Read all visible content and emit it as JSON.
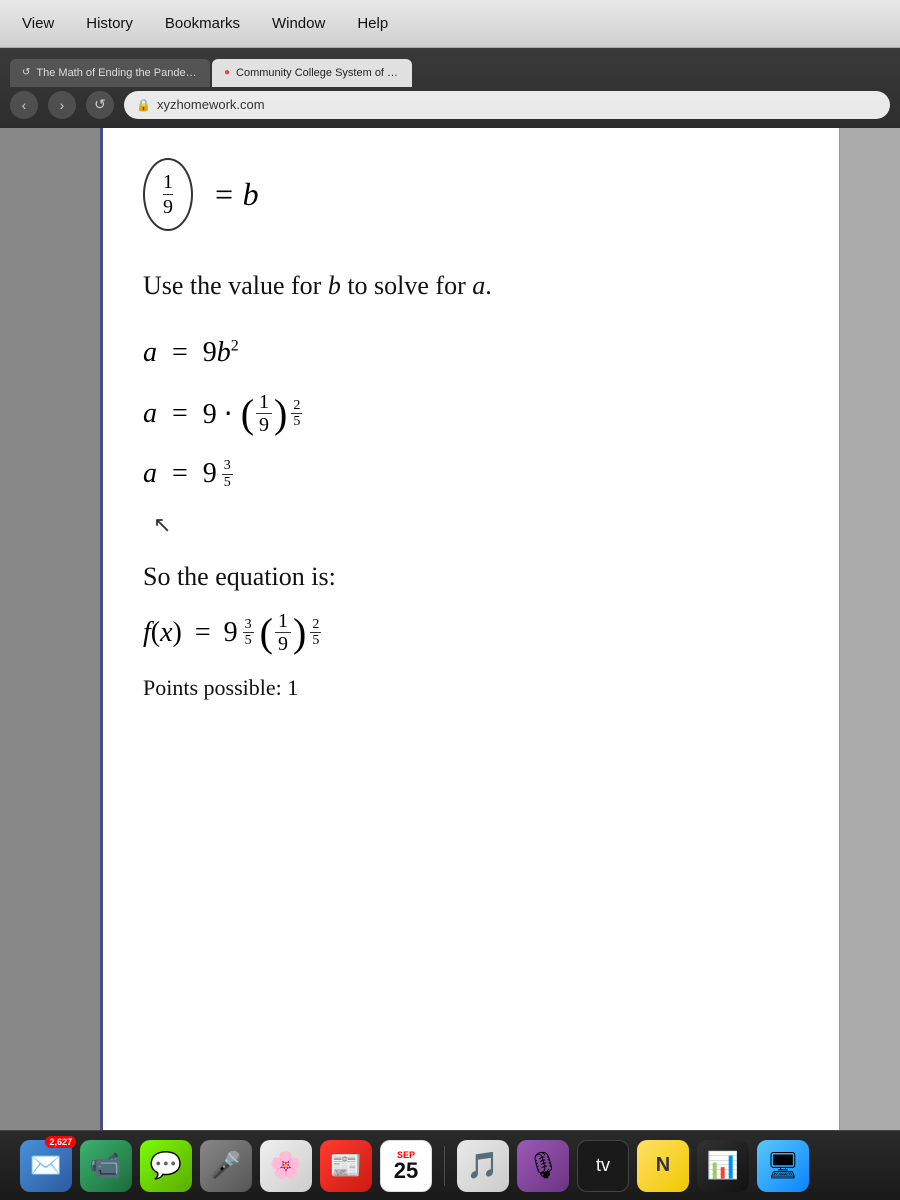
{
  "menubar": {
    "items": [
      "View",
      "History",
      "Bookmarks",
      "Window",
      "Help"
    ]
  },
  "browser": {
    "address": "xyzhomework.com",
    "lock_symbol": "🔒",
    "tabs": [
      {
        "title": "The Math of Ending the Pandemic: Expon...",
        "favicon": "↺",
        "active": false
      },
      {
        "title": "Community College System of New Ham...",
        "favicon": "○",
        "active": true
      }
    ]
  },
  "content": {
    "fraction_top": {
      "numerator": "1",
      "denominator": "9",
      "equals": "= b"
    },
    "use_value_text": "Use the value for b to solve for a.",
    "equations": [
      {
        "left": "a",
        "op": "=",
        "right": "9b²"
      },
      {
        "left": "a",
        "op": "=",
        "right": "9 · (1/9)^(2/5)"
      },
      {
        "left": "a",
        "op": "=",
        "right": "9^(3/5)"
      }
    ],
    "so_equation_text": "So the equation is:",
    "final_equation": "f(x) = 9^(3/5) · (1/9)^(2/5)",
    "points_possible": "Points possible: 1"
  },
  "dock": {
    "badge_count": "2,627",
    "calendar_month": "SEP",
    "calendar_day": "25",
    "items": [
      {
        "name": "mail",
        "emoji": "✉",
        "label": "Mail"
      },
      {
        "name": "facetime",
        "emoji": "📹",
        "label": "FaceTime"
      },
      {
        "name": "messages",
        "emoji": "💬",
        "label": "Messages"
      },
      {
        "name": "siri",
        "emoji": "🎤",
        "label": "Siri"
      },
      {
        "name": "photos",
        "emoji": "🌸",
        "label": "Photos"
      },
      {
        "name": "news",
        "emoji": "📰",
        "label": "News"
      },
      {
        "name": "calendar",
        "label": "Calendar"
      },
      {
        "name": "music",
        "emoji": "🎵",
        "label": "Music"
      },
      {
        "name": "podcasts",
        "emoji": "🎙",
        "label": "Podcasts"
      },
      {
        "name": "appletv",
        "emoji": "📺",
        "label": "Apple TV"
      },
      {
        "name": "notes",
        "emoji": "N",
        "label": "Notes"
      },
      {
        "name": "stocks",
        "emoji": "📊",
        "label": "Stocks"
      },
      {
        "name": "finder",
        "emoji": "🖥",
        "label": "Finder"
      }
    ]
  }
}
